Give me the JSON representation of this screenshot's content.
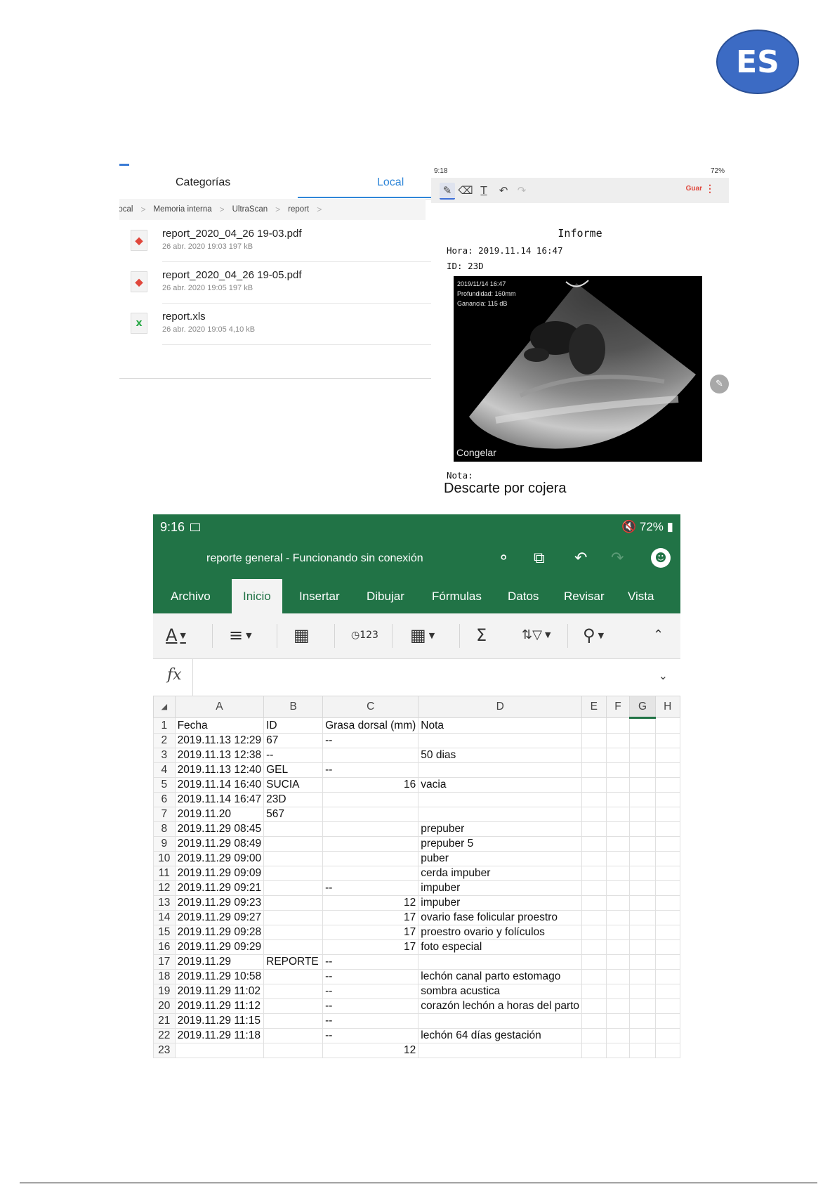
{
  "badge": {
    "text": "ES"
  },
  "file_manager": {
    "tabs": [
      "Categorías",
      "Local"
    ],
    "breadcrumb": [
      "Local",
      "Memoria interna",
      "UltraScan",
      "report"
    ],
    "files": [
      {
        "name": "report_2020_04_26 19-03.pdf",
        "meta": "26 abr. 2020 19:03 197 kB",
        "type": "pdf",
        "icon": "pdf-file-icon"
      },
      {
        "name": "report_2020_04_26 19-05.pdf",
        "meta": "26 abr. 2020 19:05 197 kB",
        "type": "pdf",
        "icon": "pdf-file-icon"
      },
      {
        "name": "report.xls",
        "meta": "26 abr. 2020 19:05 4,10 kB",
        "type": "xls",
        "icon": "xls-file-icon"
      }
    ]
  },
  "report": {
    "status": {
      "time": "9:18",
      "battery": "72%"
    },
    "toolbar": {
      "save": "Guar",
      "more": "⋮",
      "tools": [
        "pen-icon",
        "eraser-icon",
        "text-icon",
        "undo-icon",
        "redo-icon"
      ]
    },
    "title": "Informe",
    "hora": "Hora: 2019.11.14 16:47",
    "id": "ID: 23D",
    "image_overlay": [
      "2019/11/14 16:47",
      "Profundidad: 160mm",
      "Ganancia: 115 dB"
    ],
    "freeze_label": "Congelar",
    "nota_label": "Nota:",
    "nota_text": "Descarte por cojera"
  },
  "excel": {
    "status": {
      "time": "9:16",
      "battery": "72%"
    },
    "doc_title": "reporte general - Funcionando sin conexión",
    "tabs": [
      "Archivo",
      "Inicio",
      "Insertar",
      "Dibujar",
      "Fórmulas",
      "Datos",
      "Revisar",
      "Vista"
    ],
    "active_tab": "Inicio",
    "ribbon_icons": [
      "font-color-icon",
      "align-icon",
      "format-cells-icon",
      "number-format-icon",
      "borders-icon",
      "autosum-icon",
      "sort-filter-icon",
      "find-icon",
      "collapse-icon"
    ],
    "ribbon_glyphs": {
      "font_color": "A",
      "number_format": "123",
      "autosum": "Σ"
    },
    "formula_label": "fx",
    "columns": [
      "A",
      "B",
      "C",
      "D",
      "E",
      "F",
      "G",
      "H"
    ],
    "selected_column": "G",
    "rows": [
      {
        "n": "1",
        "cells": [
          "Fecha",
          "ID",
          "Grasa dorsal  (mm)",
          "Nota"
        ]
      },
      {
        "n": "2",
        "cells": [
          "2019.11.13 12:29",
          "67",
          "--",
          ""
        ]
      },
      {
        "n": "3",
        "cells": [
          "2019.11.13 12:38",
          "--",
          "",
          "50 dias"
        ]
      },
      {
        "n": "4",
        "cells": [
          "2019.11.13 12:40",
          "GEL",
          "--",
          ""
        ]
      },
      {
        "n": "5",
        "cells": [
          "2019.11.14 16:40",
          "SUCIA",
          "16",
          "vacia"
        ]
      },
      {
        "n": "6",
        "cells": [
          "2019.11.14 16:47",
          "23D",
          "",
          ""
        ]
      },
      {
        "n": "7",
        "cells": [
          "2019.11.20",
          "567",
          "",
          ""
        ]
      },
      {
        "n": "8",
        "cells": [
          "2019.11.29 08:45",
          "",
          "",
          "prepuber"
        ]
      },
      {
        "n": "9",
        "cells": [
          "2019.11.29 08:49",
          "",
          "",
          "prepuber 5"
        ]
      },
      {
        "n": "10",
        "cells": [
          "2019.11.29 09:00",
          "",
          "",
          "puber"
        ]
      },
      {
        "n": "11",
        "cells": [
          "2019.11.29 09:09",
          "",
          "",
          "cerda impuber"
        ]
      },
      {
        "n": "12",
        "cells": [
          "2019.11.29 09:21",
          "",
          "--",
          "impuber"
        ]
      },
      {
        "n": "13",
        "cells": [
          "2019.11.29 09:23",
          "",
          "12",
          "impuber"
        ]
      },
      {
        "n": "14",
        "cells": [
          "2019.11.29 09:27",
          "",
          "17",
          "ovario fase folicular proestro"
        ]
      },
      {
        "n": "15",
        "cells": [
          "2019.11.29 09:28",
          "",
          "17",
          "proestro ovario y folículos"
        ]
      },
      {
        "n": "16",
        "cells": [
          "2019.11.29 09:29",
          "",
          "17",
          "foto especial"
        ]
      },
      {
        "n": "17",
        "cells": [
          "2019.11.29",
          "REPORTE",
          "--",
          ""
        ]
      },
      {
        "n": "18",
        "cells": [
          "2019.11.29 10:58",
          "",
          "--",
          "lechón canal parto estomago"
        ]
      },
      {
        "n": "19",
        "cells": [
          "2019.11.29 11:02",
          "",
          "--",
          "sombra acustica"
        ]
      },
      {
        "n": "20",
        "cells": [
          "2019.11.29 11:12",
          "",
          "--",
          "corazón  lechón a horas del parto"
        ]
      },
      {
        "n": "21",
        "cells": [
          "2019.11.29 11:15",
          "",
          "--",
          ""
        ]
      },
      {
        "n": "22",
        "cells": [
          "2019.11.29 11:18",
          "",
          "--",
          "lechón 64 días gestación"
        ]
      },
      {
        "n": "23",
        "cells": [
          "",
          "",
          "12",
          ""
        ]
      }
    ],
    "numeric_rows": [
      "5",
      "13",
      "23"
    ]
  }
}
